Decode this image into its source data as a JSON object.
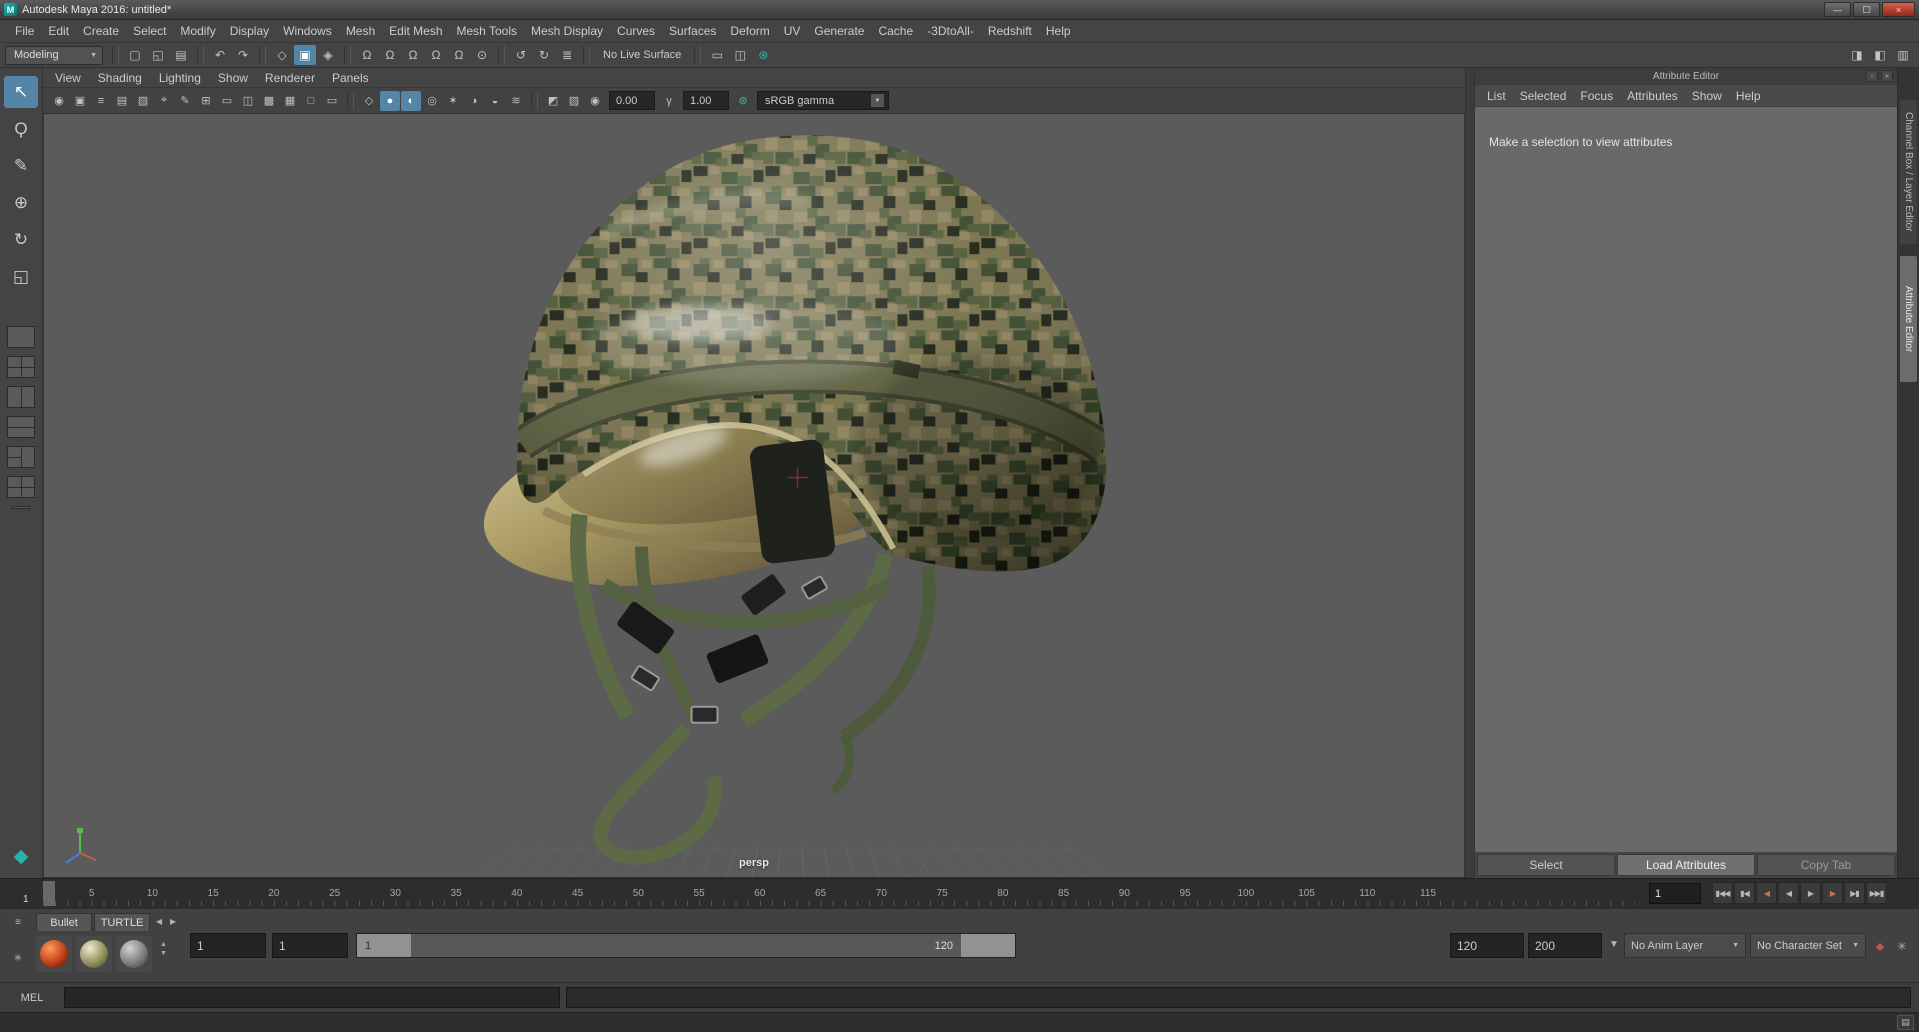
{
  "window": {
    "title": "Autodesk Maya 2016: untitled*",
    "app_icon_letter": "M",
    "minimize_glyph": "—",
    "maximize_glyph": "▢",
    "close_glyph": "×"
  },
  "menubar": {
    "items": [
      "File",
      "Edit",
      "Create",
      "Select",
      "Modify",
      "Display",
      "Windows",
      "Mesh",
      "Edit Mesh",
      "Mesh Tools",
      "Mesh Display",
      "Curves",
      "Surfaces",
      "Deform",
      "UV",
      "Generate",
      "Cache",
      "-3DtoAll-",
      "Redshift",
      "Help"
    ]
  },
  "status_line": {
    "menu_set": "Modeling",
    "live_surface_label": "No Live Surface"
  },
  "panel": {
    "menus": [
      "View",
      "Shading",
      "Lighting",
      "Show",
      "Renderer",
      "Panels"
    ],
    "exposure": "0.00",
    "gamma": "1.00",
    "view_transform": "sRGB gamma",
    "camera_label": "persp"
  },
  "attribute_editor": {
    "title": "Attribute Editor",
    "menus": [
      "List",
      "Selected",
      "Focus",
      "Attributes",
      "Show",
      "Help"
    ],
    "placeholder_message": "Make a selection to view attributes",
    "select_button": "Select",
    "load_attributes_button": "Load Attributes",
    "copy_tab_button": "Copy Tab"
  },
  "side_tabs": {
    "channel_box": "Channel Box / Layer Editor",
    "attribute_editor": "Attribute Editor"
  },
  "timeline": {
    "tick_labels": [
      "5",
      "10",
      "15",
      "20",
      "25",
      "30",
      "35",
      "40",
      "45",
      "50",
      "55",
      "60",
      "65",
      "70",
      "75",
      "80",
      "85",
      "90",
      "95",
      "100",
      "105",
      "110",
      "115"
    ],
    "current_frame": "1",
    "current_frame_field": "1"
  },
  "playback": {
    "go_to_start": "▮◀◀",
    "step_back_frame": "▮◀",
    "step_back_key": "◀",
    "play_backwards": "◀",
    "play_forward": "▶",
    "step_forward_key": "▶",
    "step_forward_frame": "▶▮",
    "go_to_end": "▶▶▮"
  },
  "range_slider": {
    "animation_start": "1",
    "playback_start": "1",
    "range_start_label": "1",
    "range_end_label": "120",
    "playback_end": "120",
    "animation_end": "200",
    "anim_layer": "No Anim Layer",
    "character_set": "No Character Set"
  },
  "shelf": {
    "tabs": [
      "Bullet",
      "TURTLE"
    ]
  },
  "command_line": {
    "label": "MEL"
  },
  "colors": {
    "accent_blue": "#5285a6",
    "viewport_bg": "#5b5b5b",
    "close_red": "#c0443a"
  },
  "icons": {
    "dropdown_caret": "▼",
    "new_scene": "▢",
    "open_scene": "◱",
    "save_scene": "▤",
    "undo": "↶",
    "redo": "↷",
    "hierarchy_mode": "◇",
    "object_mode": "▣",
    "component_mode": "◈",
    "snap_grid": "Ω",
    "snap_curve": "Ω",
    "snap_point": "Ω",
    "snap_projected_center": "Ω",
    "snap_view_plane": "Ω",
    "make_live": "⊙",
    "input_operations": "↺",
    "output_operations": "↻",
    "construction_history": "≣",
    "render_view": "▭",
    "snapshot": "◫",
    "ipr_render": "⊛",
    "sidebar_channel_box": "◨",
    "sidebar_attribute_editor": "◧",
    "sidebar_tool_settings": "▥",
    "select_camera": "◉",
    "lock_camera": "▣",
    "camera_attributes": "≡",
    "bookmarks": "▤",
    "image_plane": "▧",
    "pan_zoom": "⌖",
    "grease_pencil": "✎",
    "grid_toggle": "⊞",
    "film_gate": "▭",
    "resolution_gate": "◫",
    "gate_mask": "▩",
    "field_chart": "▦",
    "safe_action": "□",
    "safe_title": "▭",
    "wireframe": "◇",
    "smooth_shade": "●",
    "textured": "◐",
    "use_default_material": "◎",
    "lighting": "✶",
    "shadows": "◑",
    "ssao": "◒",
    "motion_blur": "≋",
    "isolate_select": "◩",
    "xray": "▨",
    "exposure": "◉",
    "gamma": "γ",
    "color_management": "⊛",
    "select_tool": "↖",
    "lasso_tool": "Ϙ",
    "paint_select_tool": "✎",
    "move_tool": "⊕",
    "rotate_tool": "↻",
    "scale_tool": "◱",
    "toolbox_poly": "◆",
    "float_panel": "▫",
    "close_panel": "×",
    "shelf_menu": "≡",
    "shelf_gear": "✳",
    "tab_prev": "◀",
    "tab_next": "▶",
    "spinner_up": "▲",
    "spinner_down": "▼",
    "range_options_caret": "▼",
    "auto_keyframe": "◆",
    "anim_preferences": "✳",
    "script_editor": "▤"
  }
}
